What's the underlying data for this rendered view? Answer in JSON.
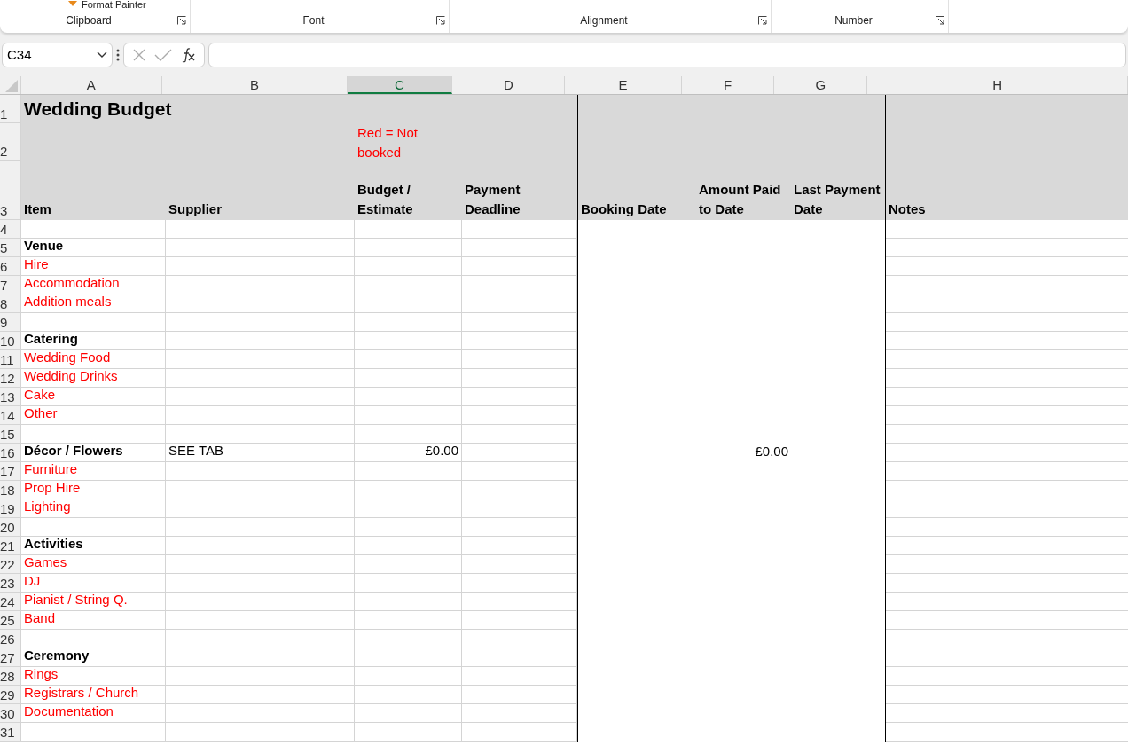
{
  "ribbon": {
    "clipboard_item": "Format Painter",
    "groups": [
      {
        "label": "Clipboard"
      },
      {
        "label": "Font"
      },
      {
        "label": "Alignment"
      },
      {
        "label": "Number"
      }
    ]
  },
  "name_box": "C34",
  "columns": [
    {
      "label": "A",
      "selected": false
    },
    {
      "label": "B",
      "selected": false
    },
    {
      "label": "C",
      "selected": true
    },
    {
      "label": "D",
      "selected": false
    },
    {
      "label": "E",
      "selected": false
    },
    {
      "label": "F",
      "selected": false
    },
    {
      "label": "G",
      "selected": false
    },
    {
      "label": "H",
      "selected": false
    }
  ],
  "rows": [
    {
      "number": "1",
      "cells": [
        {
          "kind": "title",
          "text": "Wedding Budget"
        }
      ]
    },
    {
      "number": "2",
      "cells": [
        {
          "kind": "blank"
        },
        {
          "kind": "blank"
        },
        {
          "kind": "note",
          "text": "Red = Not booked"
        }
      ]
    },
    {
      "number": "3",
      "cells": [
        {
          "kind": "header",
          "text": "Item"
        },
        {
          "kind": "header",
          "text": "Supplier"
        },
        {
          "kind": "header",
          "text": "Budget / Estimate"
        },
        {
          "kind": "header",
          "text": "Payment Deadline"
        },
        {
          "kind": "header",
          "text": "Booking Date"
        },
        {
          "kind": "header",
          "text": "Amount Paid to Date"
        },
        {
          "kind": "header",
          "text": "Last Payment Date"
        },
        {
          "kind": "header",
          "text": "Notes"
        }
      ]
    },
    {
      "number": "4",
      "cells": []
    },
    {
      "number": "5",
      "cells": [
        {
          "kind": "category",
          "text": "Venue"
        }
      ]
    },
    {
      "number": "6",
      "cells": [
        {
          "kind": "item",
          "text": "Hire"
        }
      ]
    },
    {
      "number": "7",
      "cells": [
        {
          "kind": "item",
          "text": "Accommodation"
        }
      ]
    },
    {
      "number": "8",
      "cells": [
        {
          "kind": "item",
          "text": "Addition meals"
        }
      ]
    },
    {
      "number": "9",
      "cells": []
    },
    {
      "number": "10",
      "cells": [
        {
          "kind": "category",
          "text": "Catering"
        }
      ]
    },
    {
      "number": "11",
      "cells": [
        {
          "kind": "item",
          "text": "Wedding Food"
        }
      ]
    },
    {
      "number": "12",
      "cells": [
        {
          "kind": "item",
          "text": "Wedding Drinks"
        }
      ]
    },
    {
      "number": "13",
      "cells": [
        {
          "kind": "item",
          "text": "Cake"
        }
      ]
    },
    {
      "number": "14",
      "cells": [
        {
          "kind": "item",
          "text": "Other"
        }
      ]
    },
    {
      "number": "15",
      "cells": []
    },
    {
      "number": "16",
      "cells": [
        {
          "kind": "category",
          "text": "Décor / Flowers"
        },
        {
          "kind": "plain",
          "text": "SEE TAB"
        },
        {
          "kind": "amount",
          "text": "£0.00"
        },
        {
          "kind": "blank"
        },
        {
          "kind": "blank"
        },
        {
          "kind": "amount",
          "text": "£0.00"
        }
      ]
    },
    {
      "number": "17",
      "cells": [
        {
          "kind": "item",
          "text": "Furniture"
        }
      ]
    },
    {
      "number": "18",
      "cells": [
        {
          "kind": "item",
          "text": "Prop Hire"
        }
      ]
    },
    {
      "number": "19",
      "cells": [
        {
          "kind": "item",
          "text": "Lighting"
        }
      ]
    },
    {
      "number": "20",
      "cells": []
    },
    {
      "number": "21",
      "cells": [
        {
          "kind": "category",
          "text": "Activities"
        }
      ]
    },
    {
      "number": "22",
      "cells": [
        {
          "kind": "item",
          "text": "Games"
        }
      ]
    },
    {
      "number": "23",
      "cells": [
        {
          "kind": "item",
          "text": "DJ"
        }
      ]
    },
    {
      "number": "24",
      "cells": [
        {
          "kind": "item",
          "text": "Pianist / String Q."
        }
      ]
    },
    {
      "number": "25",
      "cells": [
        {
          "kind": "item",
          "text": "Band"
        }
      ]
    },
    {
      "number": "26",
      "cells": []
    },
    {
      "number": "27",
      "cells": [
        {
          "kind": "category",
          "text": "Ceremony"
        }
      ]
    },
    {
      "number": "28",
      "cells": [
        {
          "kind": "item",
          "text": "Rings"
        }
      ]
    },
    {
      "number": "29",
      "cells": [
        {
          "kind": "item",
          "text": "Registrars / Church"
        }
      ]
    },
    {
      "number": "30",
      "cells": [
        {
          "kind": "item",
          "text": "Documentation"
        }
      ]
    },
    {
      "number": "31",
      "cells": []
    }
  ]
}
